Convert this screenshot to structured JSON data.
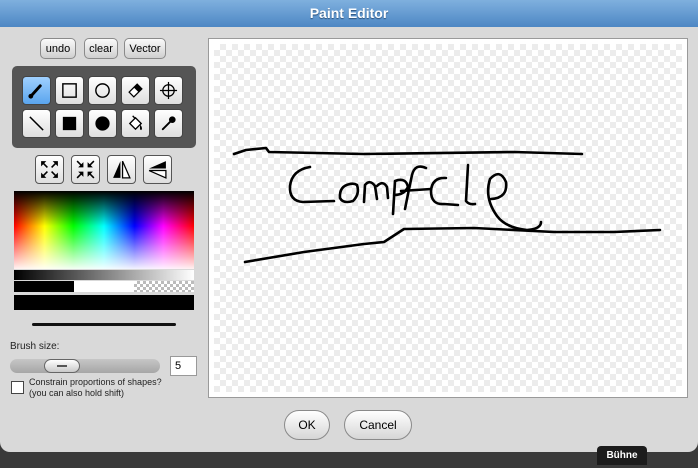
{
  "window": {
    "title": "Paint Editor"
  },
  "toolbar": {
    "undo_label": "undo",
    "clear_label": "clear",
    "vector_label": "Vector"
  },
  "tools": {
    "row1": [
      {
        "icon": "brush-icon",
        "active": true
      },
      {
        "icon": "rectangle-outline-icon"
      },
      {
        "icon": "ellipse-outline-icon"
      },
      {
        "icon": "eraser-icon"
      },
      {
        "icon": "crosshair-icon"
      }
    ],
    "row2": [
      {
        "icon": "line-icon"
      },
      {
        "icon": "rectangle-filled-icon"
      },
      {
        "icon": "ellipse-filled-icon"
      },
      {
        "icon": "paint-bucket-icon"
      },
      {
        "icon": "eyedropper-icon"
      }
    ],
    "transform": [
      "grow-icon",
      "shrink-icon",
      "flip-horizontal-icon",
      "flip-vertical-icon"
    ]
  },
  "colors": {
    "current": "#000000",
    "accent": "#5b94cf"
  },
  "brush": {
    "label": "Brush size:",
    "size": "5",
    "slider_level": 0.3
  },
  "constrain": {
    "line1": "Constrain proportions of shapes?",
    "line2": "(you can also hold shift)",
    "checked": false
  },
  "buttons": {
    "ok": "OK",
    "cancel": "Cancel"
  },
  "background_tab": {
    "label": "Bühne"
  }
}
